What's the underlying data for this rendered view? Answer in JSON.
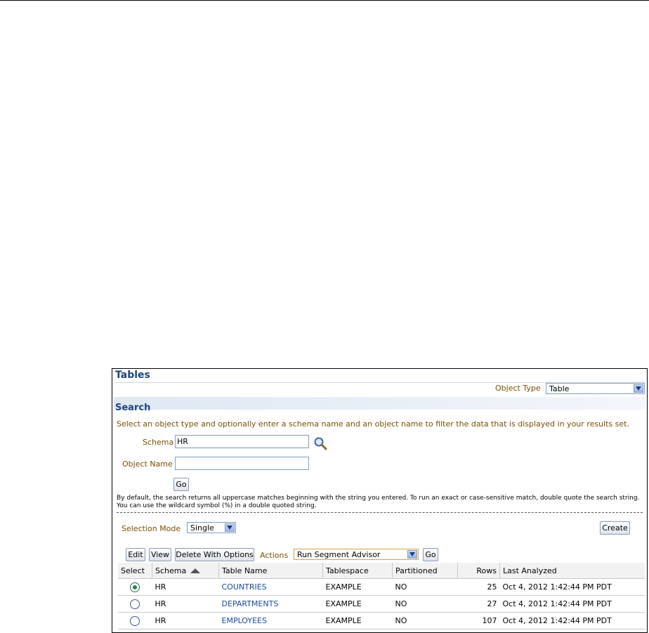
{
  "page": {
    "title": "Tables",
    "object_type_label": "Object Type",
    "object_type_value": "Table"
  },
  "search": {
    "title": "Search",
    "description": "Select an object type and optionally enter a schema name and an object name to filter the data that is displayed in your results set.",
    "schema_label": "Schema",
    "schema_value": "HR",
    "object_name_label": "Object Name",
    "object_name_value": "",
    "go_label": "Go",
    "note_line1": "By default, the search returns all uppercase matches beginning with the string you entered. To run an exact or case-sensitive match, double quote the search string.",
    "note_line2": "You can use the wildcard symbol (%) in a double quoted string."
  },
  "selection": {
    "label": "Selection Mode",
    "value": "Single",
    "create_label": "Create"
  },
  "toolbar": {
    "edit_label": "Edit",
    "view_label": "View",
    "delete_label": "Delete With Options",
    "actions_label": "Actions",
    "actions_value": "Run Segment Advisor",
    "go_label": "Go"
  },
  "table": {
    "headers": [
      "Select",
      "Schema",
      "Table Name",
      "Tablespace",
      "Partitioned",
      "Rows",
      "Last Analyzed"
    ],
    "rows": [
      {
        "selected": true,
        "schema": "HR",
        "name": "COUNTRIES",
        "tablespace": "EXAMPLE",
        "partitioned": "NO",
        "rows": "25",
        "analyzed": "Oct 4, 2012 1:42:44 PM PDT"
      },
      {
        "selected": false,
        "schema": "HR",
        "name": "DEPARTMENTS",
        "tablespace": "EXAMPLE",
        "partitioned": "NO",
        "rows": "27",
        "analyzed": "Oct 4, 2012 1:42:44 PM PDT"
      },
      {
        "selected": false,
        "schema": "HR",
        "name": "EMPLOYEES",
        "tablespace": "EXAMPLE",
        "partitioned": "NO",
        "rows": "107",
        "analyzed": "Oct 4, 2012 1:42:44 PM PDT"
      }
    ]
  },
  "colors": {
    "title": "#1a4480",
    "label": "#7a4e00",
    "link": "#1a4a99",
    "selected_radio": "#1f8a3a"
  }
}
